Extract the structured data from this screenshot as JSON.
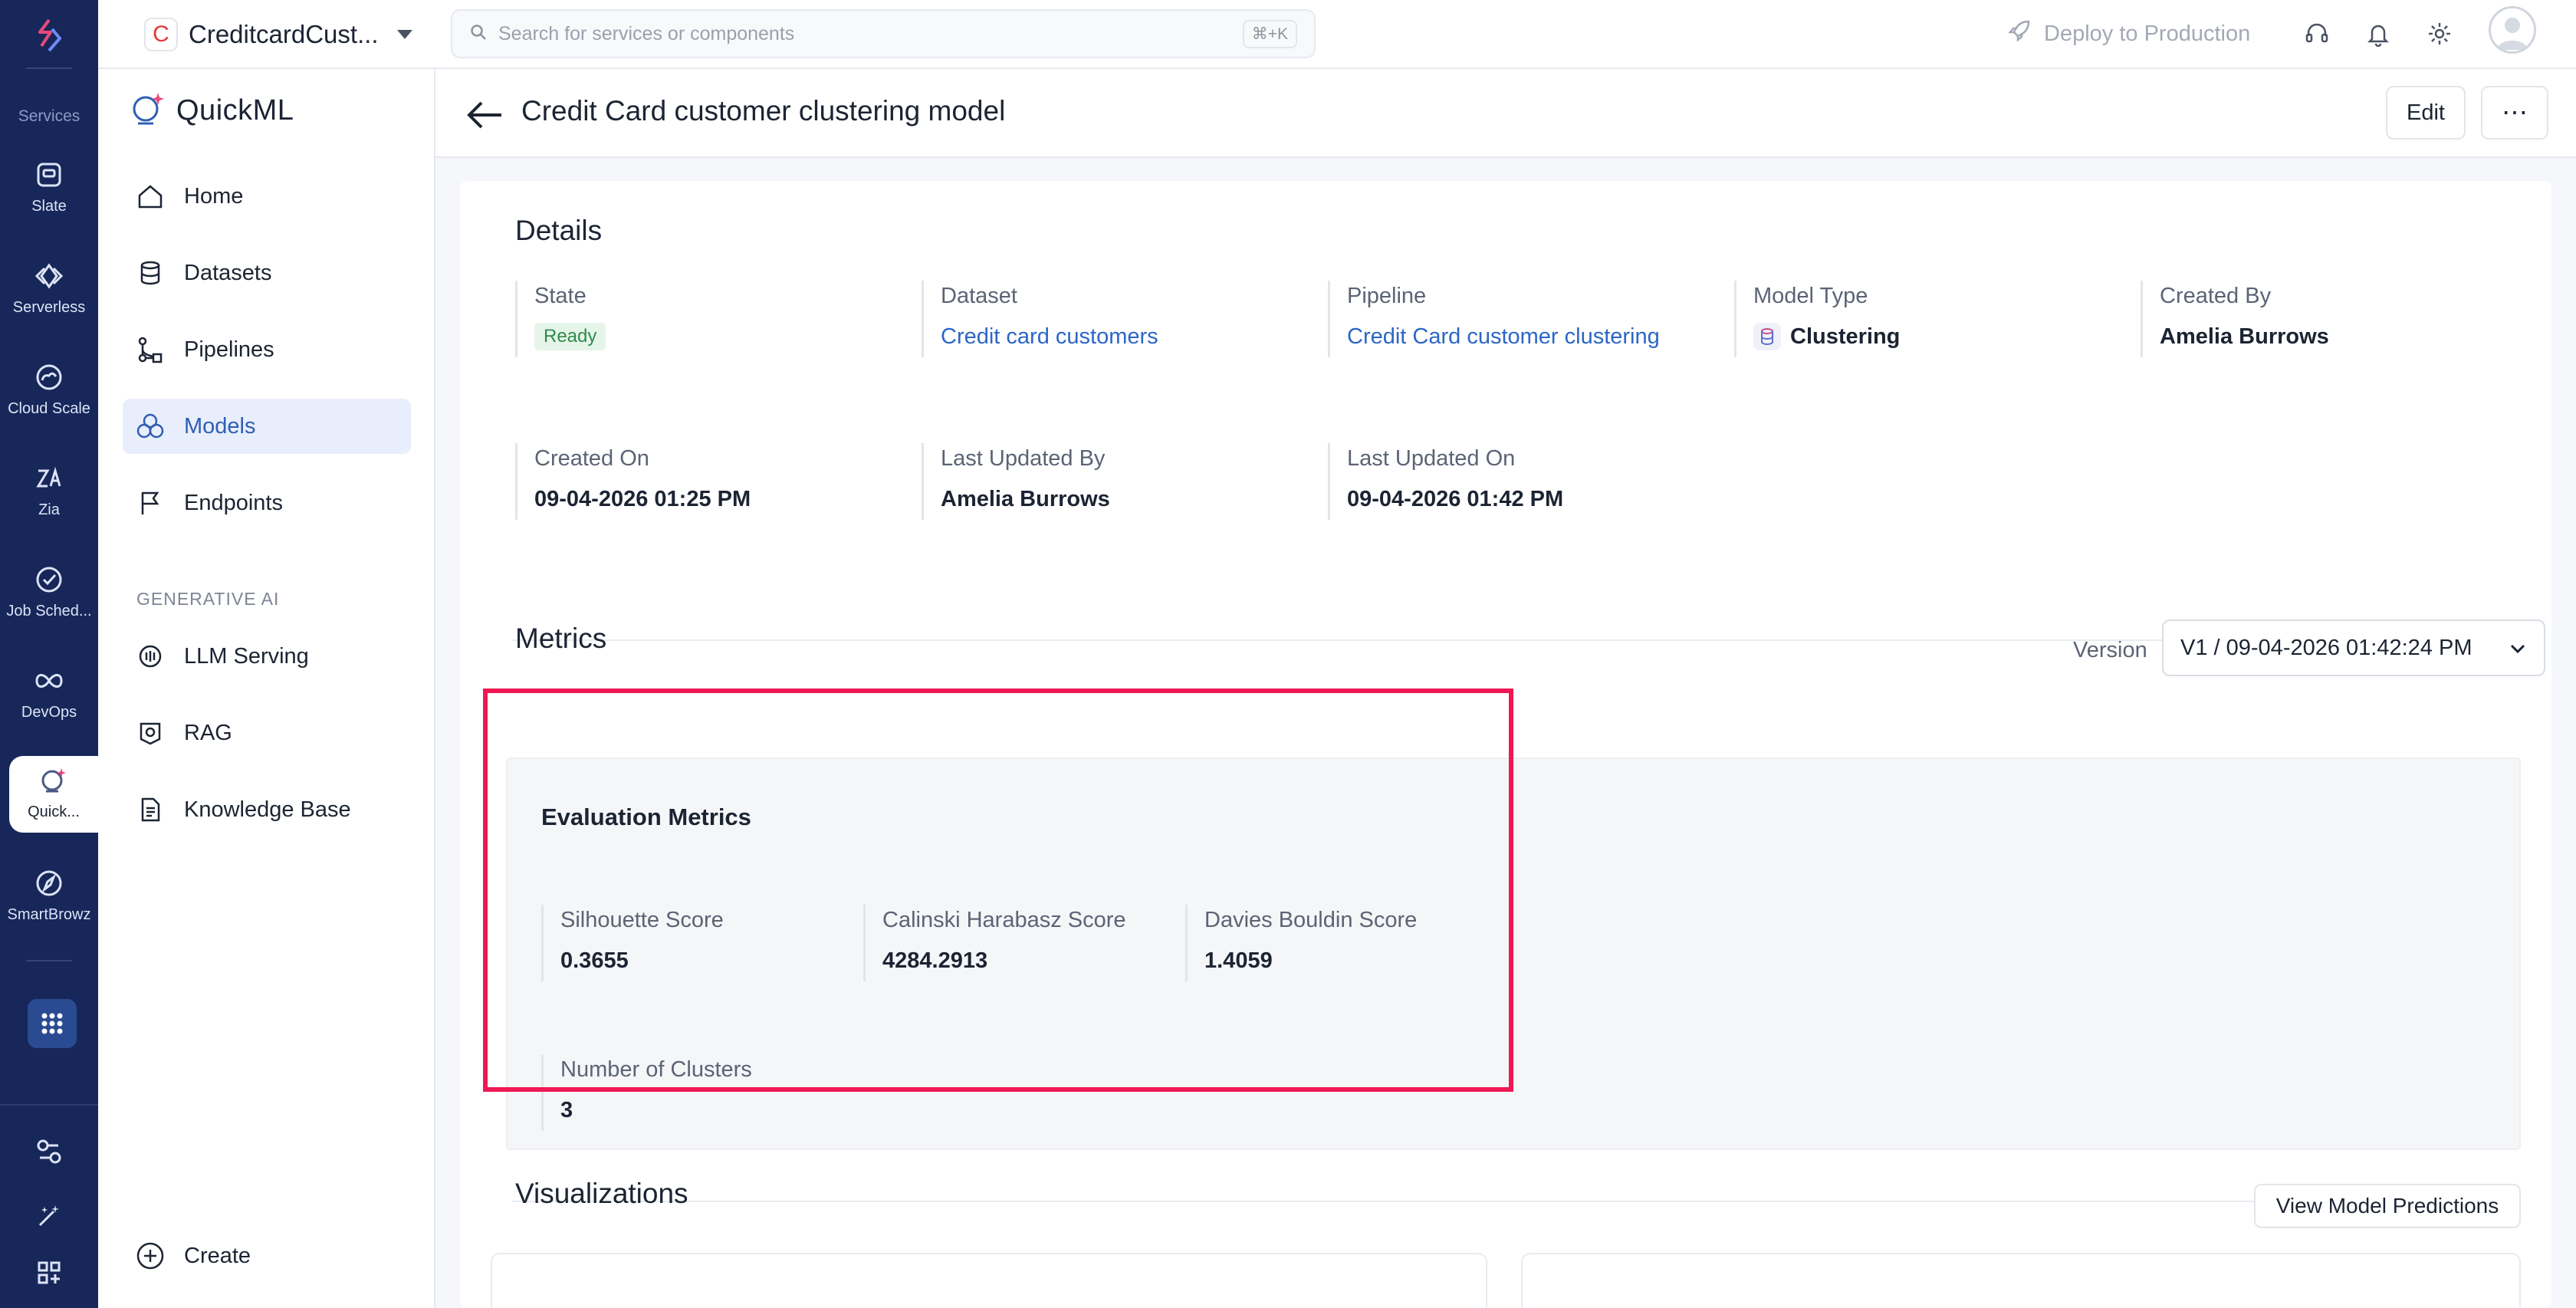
{
  "rail": {
    "section_title": "Services",
    "items": [
      {
        "label": "Slate",
        "icon": "slate-icon"
      },
      {
        "label": "Serverless",
        "icon": "code-icon"
      },
      {
        "label": "Cloud Scale",
        "icon": "cloud-icon"
      },
      {
        "label": "Zia",
        "icon": "zia-icon"
      },
      {
        "label": "Job Sched...",
        "icon": "check-circle-icon"
      },
      {
        "label": "DevOps",
        "icon": "infinity-icon"
      },
      {
        "label": "Quick...",
        "icon": "quickml-icon",
        "active": true
      },
      {
        "label": "SmartBrowz",
        "icon": "compass-icon"
      }
    ]
  },
  "topbar": {
    "project_initial": "C",
    "project_name": "CreditcardCust...",
    "search_placeholder": "Search for services or components",
    "search_shortcut": "⌘+K",
    "deploy_label": "Deploy to Production"
  },
  "sidebar": {
    "brand": "QuickML",
    "items": [
      {
        "label": "Home",
        "icon": "home-icon"
      },
      {
        "label": "Datasets",
        "icon": "database-icon"
      },
      {
        "label": "Pipelines",
        "icon": "pipeline-icon"
      },
      {
        "label": "Models",
        "icon": "models-icon",
        "active": true
      },
      {
        "label": "Endpoints",
        "icon": "flag-icon"
      }
    ],
    "genai_label": "GENERATIVE AI",
    "genai_items": [
      {
        "label": "LLM Serving",
        "icon": "llm-icon"
      },
      {
        "label": "RAG",
        "icon": "rag-icon"
      },
      {
        "label": "Knowledge Base",
        "icon": "document-icon"
      }
    ],
    "create_label": "Create"
  },
  "page": {
    "title": "Credit Card customer clustering model",
    "edit_label": "Edit",
    "more_label": "⋯"
  },
  "details": {
    "heading": "Details",
    "state_label": "State",
    "state_value": "Ready",
    "dataset_label": "Dataset",
    "dataset_value": "Credit card customers",
    "pipeline_label": "Pipeline",
    "pipeline_value": "Credit Card customer clustering",
    "model_type_label": "Model Type",
    "model_type_value": "Clustering",
    "created_by_label": "Created By",
    "created_by_value": "Amelia Burrows",
    "created_on_label": "Created On",
    "created_on_value": "09-04-2026 01:25 PM",
    "last_updated_by_label": "Last Updated By",
    "last_updated_by_value": "Amelia Burrows",
    "last_updated_on_label": "Last Updated On",
    "last_updated_on_value": "09-04-2026 01:42 PM"
  },
  "metrics": {
    "heading": "Metrics",
    "version_label": "Version",
    "version_value": "V1 / 09-04-2026 01:42:24 PM",
    "eval_title": "Evaluation Metrics",
    "items": [
      {
        "label": "Silhouette Score",
        "value": "0.3655"
      },
      {
        "label": "Calinski Harabasz Score",
        "value": "4284.2913"
      },
      {
        "label": "Davies Bouldin Score",
        "value": "1.4059"
      },
      {
        "label": "Number of Clusters",
        "value": "3"
      }
    ],
    "highlight_color": "#ee1854"
  },
  "visualizations": {
    "heading": "Visualizations",
    "view_predictions_label": "View Model Predictions"
  },
  "colors": {
    "rail_bg": "#17275a",
    "accent": "#2c66c6",
    "ready_bg": "#e6f5ea",
    "ready_text": "#2e8b4a"
  }
}
